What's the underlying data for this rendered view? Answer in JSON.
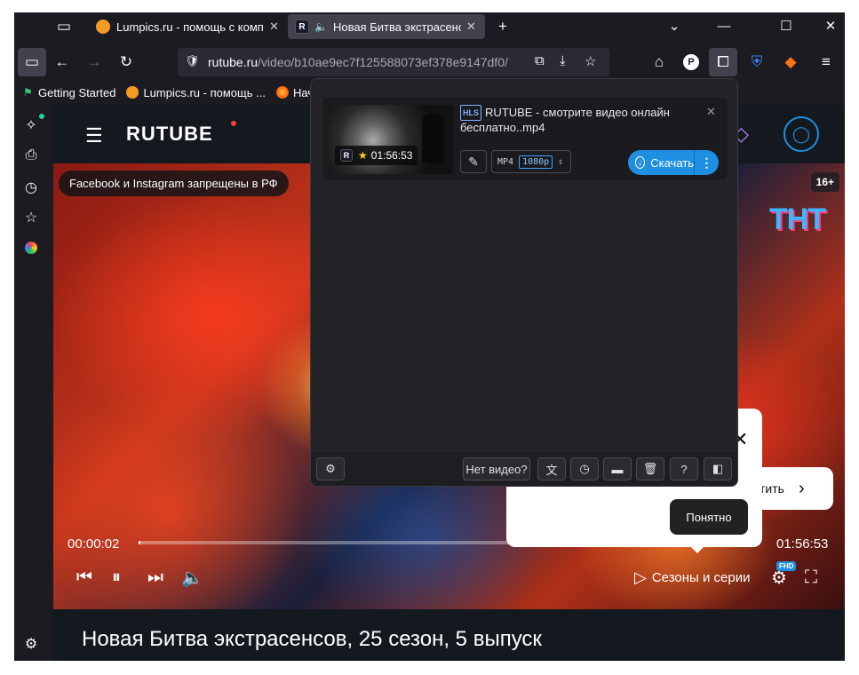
{
  "browser": {
    "tabs": [
      {
        "label": "Lumpics.ru - помощь с компьк",
        "active": false
      },
      {
        "label": "Новая Битва экстрасенсов",
        "active": true
      }
    ],
    "url_host": "rutube.ru",
    "url_path": "/video/b10ae9ec7f125588073ef378e9147df0/",
    "bookmarks": [
      "Getting Started",
      "Lumpics.ru - помощь ...",
      "Начал"
    ]
  },
  "page": {
    "logo": "RUTUBE",
    "banner": "Facebook и Instagram запрещены в РФ",
    "age_rating": "16+",
    "channel_logo": "ТНТ",
    "time_current": "00:00:02",
    "time_total": "01:56:53",
    "progress_fraction": 0.0003,
    "seasons_label": "Сезоны и серии",
    "quality_badge": "FHD",
    "tooltip_ok": "Понятно",
    "next_partial": "стить",
    "video_title": "Новая Битва экстрасенсов, 25 сезон, 5 выпуск"
  },
  "popup": {
    "item": {
      "badge": "HLS",
      "title": "RUTUBE - смотрите видео онлайн бесплатно..mp4",
      "duration": "01:56:53",
      "format": "MP4",
      "quality": "1080p",
      "download_label": "Скачать"
    },
    "footer": {
      "no_video_label": "Нет видео?"
    }
  },
  "colors": {
    "accent_download": "#1e8fe1",
    "rutube_dot": "#ff3b3b"
  }
}
